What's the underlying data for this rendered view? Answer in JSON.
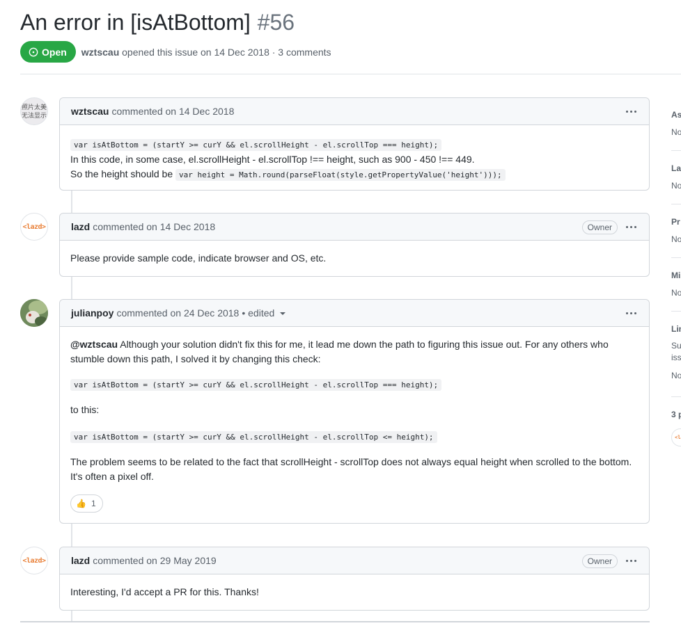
{
  "issue": {
    "title": "An error in [isAtBottom]",
    "number": "#56",
    "state": "Open",
    "author": "wztscau",
    "meta": "opened this issue on 14 Dec 2018 · 3 comments"
  },
  "comments": [
    {
      "author": "wztscau",
      "action": "commented on 14 Dec 2018",
      "avatar_text": [
        "照片太美",
        "无法显示"
      ],
      "code1": "var isAtBottom = (startY >= curY && el.scrollHeight - el.scrollTop === height);",
      "line2": "In this code, in some case, el.scrollHeight - el.scrollTop !== height, such as 900 - 450 !== 449.",
      "line3_prefix": "So the height should be ",
      "code2": "var height = Math.round(parseFloat(style.getPropertyValue('height')));"
    },
    {
      "author": "lazd",
      "action": "commented on 14 Dec 2018",
      "badge": "Owner",
      "avatar_text": "<lazd>",
      "body": "Please provide sample code, indicate browser and OS, etc."
    },
    {
      "author": "julianpoy",
      "action": "commented on 24 Dec 2018",
      "edited": "• edited",
      "mention": "@wztscau",
      "para1": " Although your solution didn't fix this for me, it lead me down the path to figuring this issue out. For any others who stumble down this path, I solved it by changing this check:",
      "code1": "var isAtBottom = (startY >= curY && el.scrollHeight - el.scrollTop === height);",
      "para2": "to this:",
      "code2": "var isAtBottom = (startY >= curY && el.scrollHeight - el.scrollTop <= height);",
      "para3": "The problem seems to be related to the fact that scrollHeight - scrollTop does not always equal height when scrolled to the bottom. It's often a pixel off.",
      "reaction_emoji": "👍",
      "reaction_count": "1"
    },
    {
      "author": "lazd",
      "action": "commented on 29 May 2019",
      "badge": "Owner",
      "avatar_text": "<lazd>",
      "body": "Interesting, I'd accept a PR for this. Thanks!"
    }
  ],
  "sidebar": {
    "assignees": {
      "head": "As",
      "value": "No"
    },
    "labels": {
      "head": "La",
      "value": "No"
    },
    "projects": {
      "head": "Pr",
      "value": "No"
    },
    "milestone": {
      "head": "Mi",
      "value": "No"
    },
    "linked": {
      "head": "Lin",
      "line1": "Su",
      "line2": "iss",
      "value": "No"
    },
    "participants": {
      "head": "3 p",
      "avatar_text": "<la"
    }
  },
  "colors": {
    "open_green": "#28a745",
    "border": "#d1d5da",
    "header_bg": "#f6f8fa",
    "muted": "#586069"
  }
}
